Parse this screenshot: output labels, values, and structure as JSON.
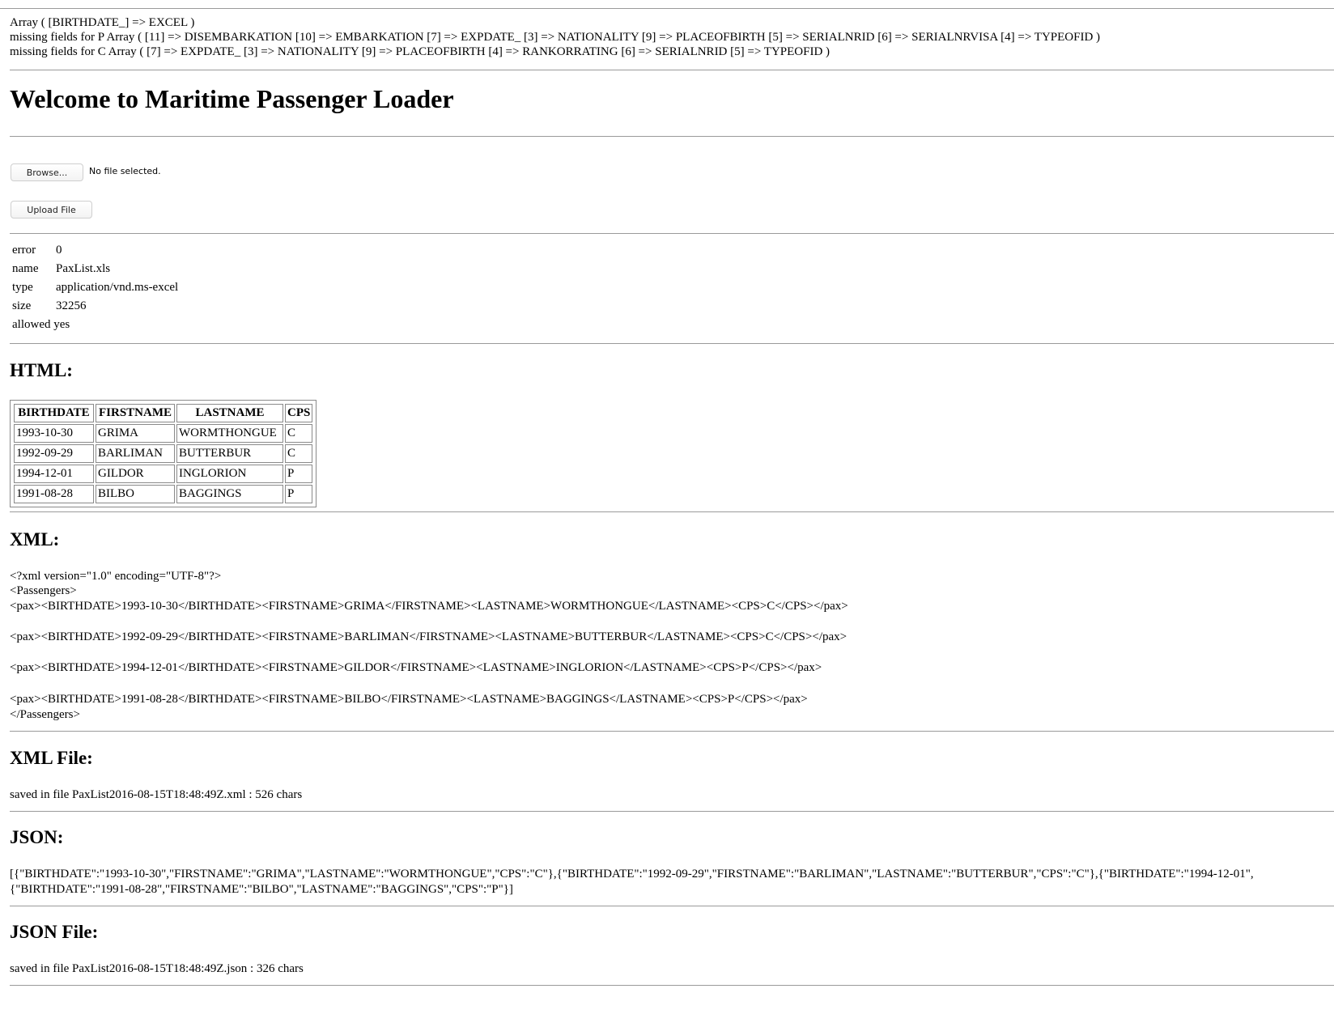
{
  "debug": {
    "line1": "Array ( [BIRTHDATE_] => EXCEL )",
    "line2": "missing fields for P Array ( [11] => DISEMBARKATION [10] => EMBARKATION [7] => EXPDATE_ [3] => NATIONALITY [9] => PLACEOFBIRTH [5] => SERIALNRID [6] => SERIALNRVISA [4] => TYPEOFID )",
    "line3": "missing fields for C Array ( [7] => EXPDATE_ [3] => NATIONALITY [9] => PLACEOFBIRTH [4] => RANKORRATING [6] => SERIALNRID [5] => TYPEOFID )"
  },
  "title": "Welcome to Maritime Passenger Loader",
  "upload": {
    "browse_label": "Browse...",
    "no_file_text": "No file selected.",
    "upload_label": "Upload File"
  },
  "file_info": [
    {
      "key": "error",
      "value": "0"
    },
    {
      "key": "name",
      "value": "PaxList.xls"
    },
    {
      "key": "type",
      "value": "application/vnd.ms-excel"
    },
    {
      "key": "size",
      "value": "32256"
    },
    {
      "key": "allowed",
      "value": "yes"
    }
  ],
  "sections": {
    "html": "HTML:",
    "xml": "XML:",
    "xml_file": "XML File:",
    "json": "JSON:",
    "json_file": "JSON File:"
  },
  "table": {
    "headers": [
      "BIRTHDATE",
      "FIRSTNAME",
      "LASTNAME",
      "CPS"
    ],
    "rows": [
      [
        "1993-10-30",
        "GRIMA",
        "WORMTHONGUE",
        "C"
      ],
      [
        "1992-09-29",
        "BARLIMAN",
        "BUTTERBUR",
        "C"
      ],
      [
        "1994-12-01",
        "GILDOR",
        "INGLORION",
        "P"
      ],
      [
        "1991-08-28",
        "BILBO",
        "BAGGINGS",
        "P"
      ]
    ]
  },
  "xml": {
    "decl": "<?xml version=\"1.0\" encoding=\"UTF-8\"?>",
    "open": "<Passengers>",
    "pax": [
      "<pax><BIRTHDATE>1993-10-30</BIRTHDATE><FIRSTNAME>GRIMA</FIRSTNAME><LASTNAME>WORMTHONGUE</LASTNAME><CPS>C</CPS></pax>",
      "<pax><BIRTHDATE>1992-09-29</BIRTHDATE><FIRSTNAME>BARLIMAN</FIRSTNAME><LASTNAME>BUTTERBUR</LASTNAME><CPS>C</CPS></pax>",
      "<pax><BIRTHDATE>1994-12-01</BIRTHDATE><FIRSTNAME>GILDOR</FIRSTNAME><LASTNAME>INGLORION</LASTNAME><CPS>P</CPS></pax>",
      "<pax><BIRTHDATE>1991-08-28</BIRTHDATE><FIRSTNAME>BILBO</FIRSTNAME><LASTNAME>BAGGINGS</LASTNAME><CPS>P</CPS></pax>"
    ],
    "close": "</Passengers>"
  },
  "xml_file_text": "saved in file PaxList2016-08-15T18:48:49Z.xml : 526 chars",
  "json": {
    "line1": "[{\"BIRTHDATE\":\"1993-10-30\",\"FIRSTNAME\":\"GRIMA\",\"LASTNAME\":\"WORMTHONGUE\",\"CPS\":\"C\"},{\"BIRTHDATE\":\"1992-09-29\",\"FIRSTNAME\":\"BARLIMAN\",\"LASTNAME\":\"BUTTERBUR\",\"CPS\":\"C\"},{\"BIRTHDATE\":\"1994-12-01\",",
    "line2": "{\"BIRTHDATE\":\"1991-08-28\",\"FIRSTNAME\":\"BILBO\",\"LASTNAME\":\"BAGGINGS\",\"CPS\":\"P\"}]"
  },
  "json_file_text": "saved in file PaxList2016-08-15T18:48:49Z.json : 326 chars"
}
